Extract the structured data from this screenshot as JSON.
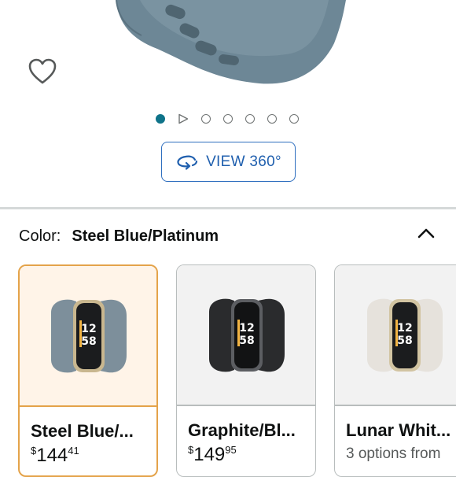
{
  "product_gallery": {
    "wishlist_icon": "heart-outline-icon",
    "carousel": {
      "total_dots": 7,
      "active_index": 0,
      "video_slot_index": 1
    },
    "view_360_label": "VIEW 360°",
    "view_360_icon": "rotate-360-icon"
  },
  "variation": {
    "label": "Color:",
    "selected_value": "Steel Blue/Platinum",
    "collapse_icon": "chevron-up-icon",
    "options": [
      {
        "name": "Steel Blue/...",
        "price_symbol": "$",
        "price_whole": "144",
        "price_fraction": "41",
        "band_color": "#7d8f9b",
        "selected": true
      },
      {
        "name": "Graphite/Bl...",
        "price_symbol": "$",
        "price_whole": "149",
        "price_fraction": "95",
        "band_color": "#2a2b2d",
        "selected": false
      },
      {
        "name": "Lunar Whit...",
        "options_text": "3 options from",
        "band_color": "#e6e2dc",
        "selected": false
      }
    ]
  },
  "colors": {
    "accent_teal": "#0f7389",
    "link_blue": "#1f5fae",
    "selected_border": "#e4a34a",
    "band_steel_blue": "#6d8796"
  }
}
